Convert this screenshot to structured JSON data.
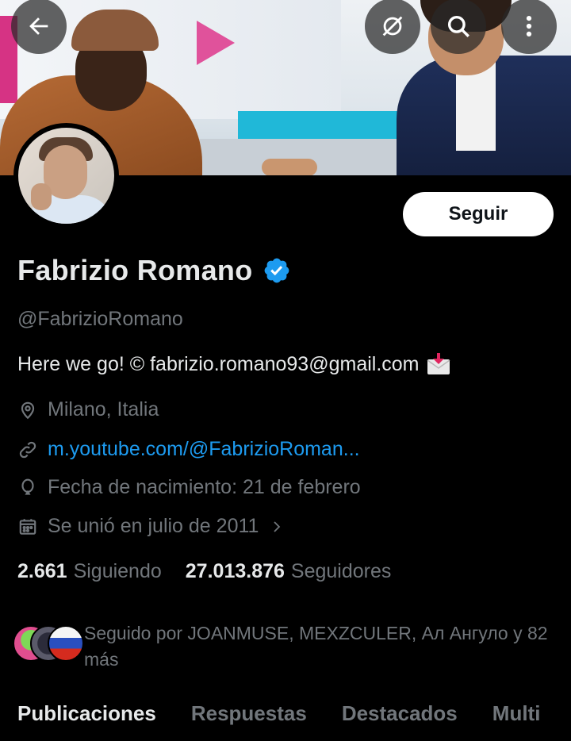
{
  "header": {
    "back_icon": "back-arrow-icon",
    "hide_icon": "eye-slash-icon",
    "search_icon": "search-icon",
    "more_icon": "more-vertical-icon"
  },
  "profile": {
    "follow_label": "Seguir",
    "name": "Fabrizio Romano",
    "verified_icon": "verified-badge-icon",
    "handle": "@FabrizioRomano",
    "bio": "Here we go! © fabrizio.romano93@gmail.com",
    "bio_icon": "incoming-envelope-icon",
    "location": "Milano, Italia",
    "website": "m.youtube.com/@FabrizioRoman...",
    "birthday": "Fecha de nacimiento: 21 de febrero",
    "joined": "Se unió en julio de 2011"
  },
  "stats": {
    "following_count": "2.661",
    "following_label": "Siguiendo",
    "followers_count": "27.013.876",
    "followers_label": "Seguidores"
  },
  "followed_by": {
    "text": "Seguido por JOANMUSE, MEXZCULER, Ал Ангуло y 82 más"
  },
  "tabs": [
    {
      "label": "Publicaciones",
      "active": true
    },
    {
      "label": "Respuestas",
      "active": false
    },
    {
      "label": "Destacados",
      "active": false
    },
    {
      "label": "Multi",
      "active": false
    }
  ],
  "colors": {
    "background": "#000000",
    "text_primary": "#e7e9ea",
    "text_secondary": "#71767b",
    "link": "#1d9bf0",
    "verified": "#1d9bf0"
  }
}
